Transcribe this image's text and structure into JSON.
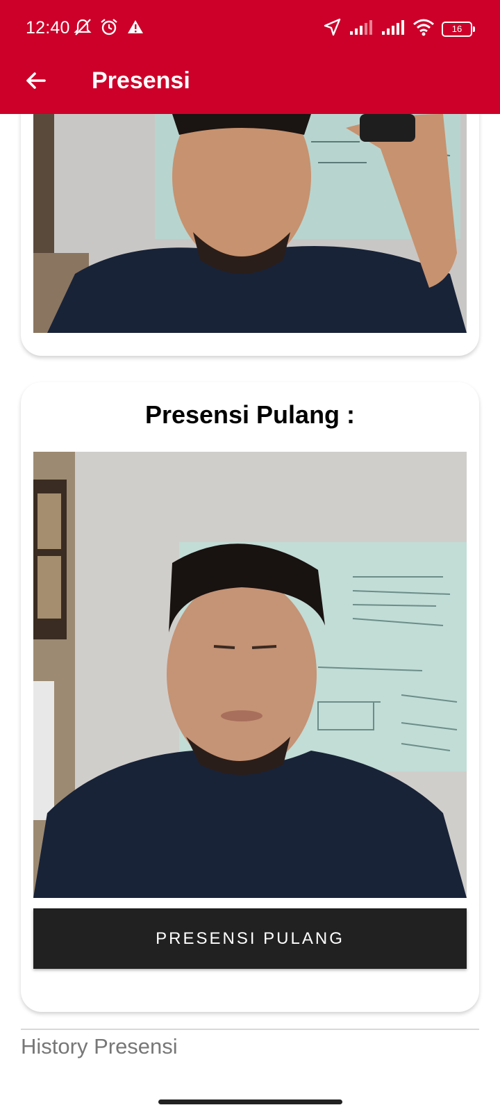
{
  "status_bar": {
    "time": "12:40",
    "battery": "16",
    "left_icons": [
      "mute-notifications-icon",
      "alarm-icon",
      "warning-icon"
    ],
    "right_icons": [
      "location-icon",
      "signal-icon",
      "signal-icon",
      "wifi-icon",
      "battery-icon"
    ]
  },
  "app_bar": {
    "title": "Presensi",
    "back_icon": "arrow-back-icon",
    "background": "#cc0029"
  },
  "checkin_card": {
    "photo": "selfie-photo"
  },
  "checkout_card": {
    "heading": "Presensi Pulang :",
    "photo": "selfie-photo",
    "button_label": "PRESENSI PULANG"
  },
  "history": {
    "label": "History Presensi"
  }
}
